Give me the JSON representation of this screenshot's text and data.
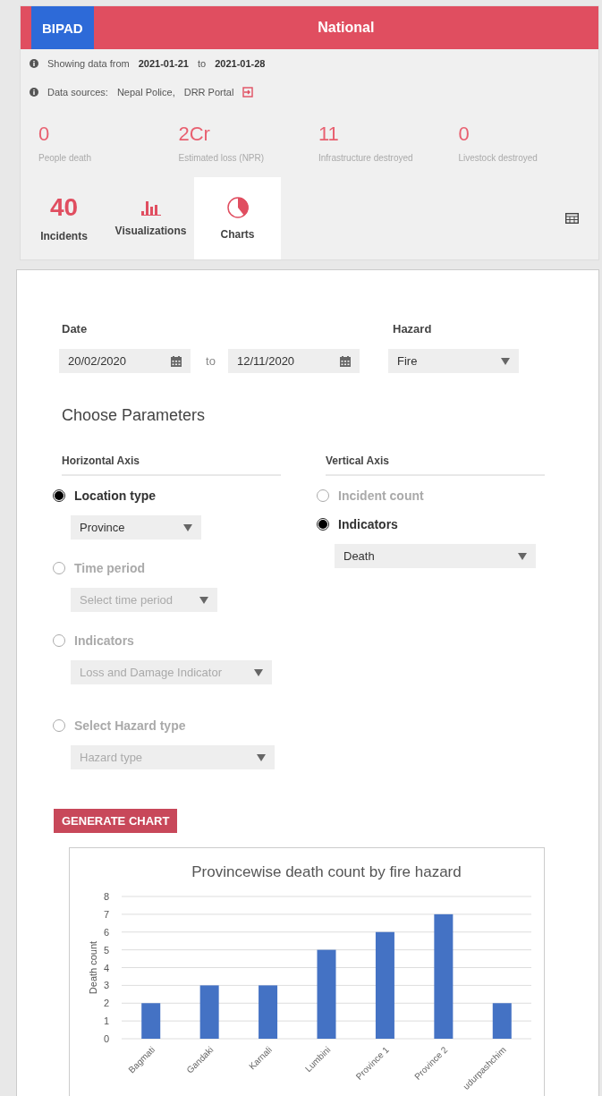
{
  "header": {
    "logo": "BIPAD",
    "region": "National"
  },
  "info": [
    {
      "label": "Showing data from",
      "parts": [
        "2021-01-21",
        "to",
        "2021-01-28"
      ]
    },
    {
      "label": "Data sources:",
      "parts": [
        "Nepal Police,",
        "DRR Portal"
      ],
      "link_icon": true
    }
  ],
  "stats": [
    {
      "value": "0",
      "label": "People death"
    },
    {
      "value": "2Cr",
      "label": "Estimated loss (NPR)"
    },
    {
      "value": "11",
      "label": "Infrastructure destroyed"
    },
    {
      "value": "0",
      "label": "Livestock destroyed"
    }
  ],
  "tabs": [
    {
      "kind": "count",
      "value": "40",
      "label": "Incidents",
      "selected": false
    },
    {
      "kind": "bars",
      "label": "Visualizations",
      "selected": false
    },
    {
      "kind": "pie",
      "label": "Charts",
      "selected": true
    }
  ],
  "form": {
    "date_label": "Date",
    "date_from": "20/02/2020",
    "date_sep": "to",
    "date_to": "12/11/2020",
    "hazard_label": "Hazard",
    "hazard_value": "Fire",
    "title": "Choose Parameters",
    "horizontal": {
      "title": "Horizontal Axis",
      "options": [
        {
          "label": "Location type",
          "selected": true,
          "disabled": false,
          "select": {
            "value": "Province"
          }
        },
        {
          "label": "Time period",
          "selected": false,
          "disabled": true,
          "select": {
            "placeholder": "Select time period"
          }
        },
        {
          "label": "Indicators",
          "selected": false,
          "disabled": true,
          "select": {
            "placeholder": "Loss and Damage Indicator"
          }
        },
        {
          "label": "Select Hazard type",
          "selected": false,
          "disabled": true,
          "select": {
            "placeholder": "Hazard type"
          }
        }
      ]
    },
    "vertical": {
      "title": "Vertical Axis",
      "options": [
        {
          "label": "Incident count",
          "selected": false,
          "disabled": true
        },
        {
          "label": "Indicators",
          "selected": true,
          "disabled": false,
          "select": {
            "value": "Death"
          }
        }
      ]
    },
    "button": "GENERATE CHART"
  },
  "chart_data": {
    "type": "bar",
    "title": "Provincewise death count by fire hazard",
    "ylabel": "Death count",
    "categories": [
      "Bagmati",
      "Gandaki",
      "Karnali",
      "Lumbini",
      "Province 1",
      "Province 2",
      "udurpashchim"
    ],
    "values": [
      2,
      3,
      3,
      5,
      6,
      7,
      2
    ],
    "ylim": [
      0,
      8
    ],
    "grid": true,
    "yticks": [
      0,
      1,
      2,
      3,
      4,
      5,
      6,
      7,
      8
    ]
  }
}
